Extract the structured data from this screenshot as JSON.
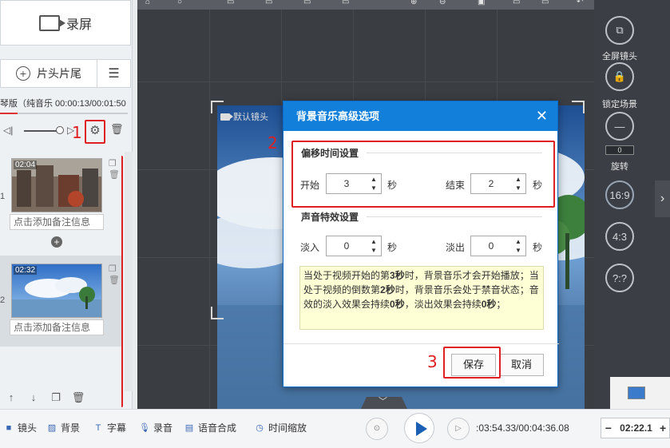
{
  "left_panel": {
    "record_label": "录屏",
    "intro_outro_label": "片头片尾",
    "music_info": "琴版（纯音乐 00:00:13/00:01:50",
    "music_progress": 0.14,
    "clips": [
      {
        "time": "02:04",
        "note_placeholder": "点击添加备注信息",
        "index": "1"
      },
      {
        "time": "02:32",
        "note_placeholder": "点击添加备注信息",
        "index": "2"
      }
    ]
  },
  "annotations": {
    "step1": "1",
    "step2": "2",
    "step3": "3"
  },
  "stage": {
    "camera_label": "默认镜头"
  },
  "right_rail": {
    "fullscreen_label": "全屏镜头",
    "lock_label": "锁定场景",
    "rotate_value": "0",
    "rotate_label": "旋转",
    "ratio_169": "16:9",
    "ratio_43": "4:3",
    "ratio_custom": "?:?"
  },
  "dialog": {
    "title": "背景音乐高级选项",
    "offset_section": "偏移时间设置",
    "start_label": "开始",
    "start_value": "3",
    "end_label": "结束",
    "end_value": "2",
    "unit_sec": "秒",
    "effect_section": "声音特效设置",
    "fade_in_label": "淡入",
    "fade_in_value": "0",
    "fade_out_label": "淡出",
    "fade_out_value": "0",
    "note_parts": [
      "当处于视频开始的第",
      "3秒",
      "时，背景音乐才会开始播放；当处于视频的倒数第",
      "2秒",
      "时，背景音乐会处于禁音状态；音效的淡入效果会持续",
      "0秒",
      "，淡出效果会持续",
      "0秒",
      "；"
    ],
    "save_label": "保存",
    "cancel_label": "取消"
  },
  "bottom_bar": {
    "lens_label": "镜头",
    "bg_label": "背景",
    "caption_label": "字幕",
    "record_audio_label": "录音",
    "tts_label": "语音合成",
    "time_scale_label": "时间缩放",
    "timecode": ":03:54.33/00:04:36.08",
    "zoom_value": "02:22.1"
  },
  "colors": {
    "dialog_header": "#1280da",
    "annotation_red": "#e02020",
    "note_bg": "#ffffd5",
    "play_blue": "#1a5fb4"
  }
}
